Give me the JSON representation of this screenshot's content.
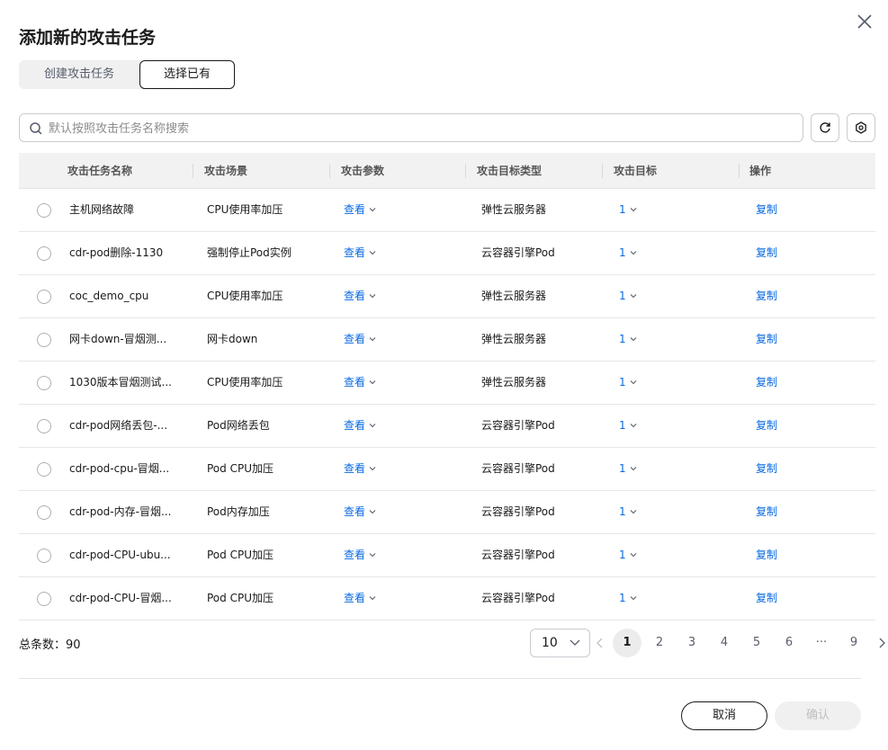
{
  "dialog": {
    "title": "添加新的攻击任务"
  },
  "segment": {
    "options": [
      "创建攻击任务",
      "选择已有"
    ],
    "selected": "选择已有"
  },
  "search": {
    "placeholder": "默认按照攻击任务名称搜索",
    "value": ""
  },
  "table": {
    "columns": [
      "攻击任务名称",
      "攻击场景",
      "攻击参数",
      "攻击目标类型",
      "攻击目标",
      "操作"
    ],
    "rows": [
      {
        "name": "主机网络故障",
        "scene": "CPU使用率加压",
        "params": "查看",
        "target_type": "弹性云服务器",
        "target": "1",
        "action": "复制"
      },
      {
        "name": "cdr-pod删除-1130",
        "scene": "强制停止Pod实例",
        "params": "查看",
        "target_type": "云容器引擎Pod",
        "target": "1",
        "action": "复制"
      },
      {
        "name": "coc_demo_cpu",
        "scene": "CPU使用率加压",
        "params": "查看",
        "target_type": "弹性云服务器",
        "target": "1",
        "action": "复制"
      },
      {
        "name": "网卡down-冒烟测...",
        "scene": "网卡down",
        "params": "查看",
        "target_type": "弹性云服务器",
        "target": "1",
        "action": "复制"
      },
      {
        "name": "1030版本冒烟测试...",
        "scene": "CPU使用率加压",
        "params": "查看",
        "target_type": "弹性云服务器",
        "target": "1",
        "action": "复制"
      },
      {
        "name": "cdr-pod网络丢包-...",
        "scene": "Pod网络丢包",
        "params": "查看",
        "target_type": "云容器引擎Pod",
        "target": "1",
        "action": "复制"
      },
      {
        "name": "cdr-pod-cpu-冒烟...",
        "scene": "Pod CPU加压",
        "params": "查看",
        "target_type": "云容器引擎Pod",
        "target": "1",
        "action": "复制"
      },
      {
        "name": "cdr-pod-内存-冒烟...",
        "scene": "Pod内存加压",
        "params": "查看",
        "target_type": "云容器引擎Pod",
        "target": "1",
        "action": "复制"
      },
      {
        "name": "cdr-pod-CPU-ubu...",
        "scene": "Pod CPU加压",
        "params": "查看",
        "target_type": "云容器引擎Pod",
        "target": "1",
        "action": "复制"
      },
      {
        "name": "cdr-pod-CPU-冒烟...",
        "scene": "Pod CPU加压",
        "params": "查看",
        "target_type": "云容器引擎Pod",
        "target": "1",
        "action": "复制"
      }
    ]
  },
  "pagination": {
    "total_label": "总条数：90",
    "page_size": "10",
    "pages": [
      "1",
      "2",
      "3",
      "4",
      "5",
      "6",
      "···",
      "9"
    ],
    "current": "1"
  },
  "footer": {
    "cancel_label": "取消",
    "confirm_label": "确认"
  },
  "colors": {
    "link": "#0a6ae0",
    "header_bg": "#f2f2f2",
    "disabled_text": "#c0c0c0"
  }
}
